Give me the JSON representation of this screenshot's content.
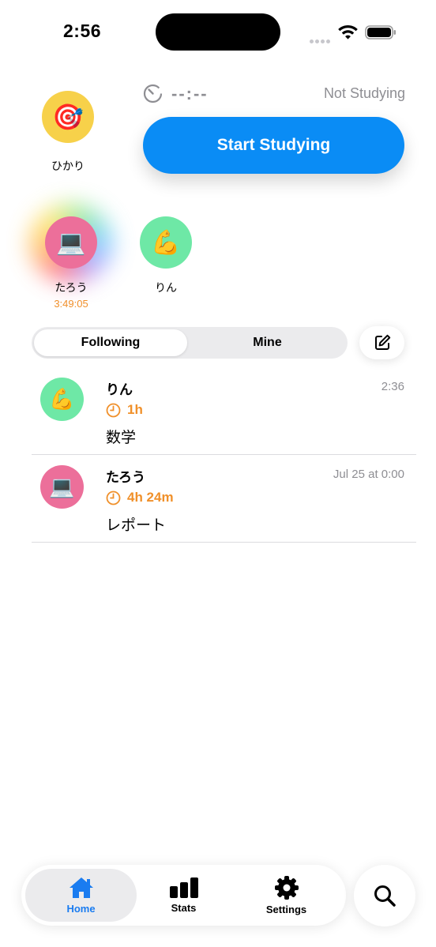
{
  "status_bar": {
    "time": "2:56"
  },
  "profile": {
    "name": "ひかり",
    "avatar_emoji": "🎯",
    "avatar_color": "#f7d14a"
  },
  "timer": {
    "display": "--:--",
    "status": "Not Studying"
  },
  "start_button": {
    "label": "Start Studying",
    "color": "#0a8cf5"
  },
  "friends": [
    {
      "name": "たろう",
      "avatar_emoji": "💻",
      "avatar_color": "#ec6f9a",
      "elapsed": "3:49:05",
      "studying": true
    },
    {
      "name": "りん",
      "avatar_emoji": "💪",
      "avatar_color": "#6ee8a6",
      "elapsed": "",
      "studying": false
    }
  ],
  "segment": {
    "options": [
      "Following",
      "Mine"
    ],
    "selected": "Following"
  },
  "feed": [
    {
      "name": "りん",
      "avatar_emoji": "💪",
      "avatar_color": "#6ee8a6",
      "time": "2:36",
      "duration": "1h",
      "subject": "数学"
    },
    {
      "name": "たろう",
      "avatar_emoji": "💻",
      "avatar_color": "#ec6f9a",
      "time": "Jul 25 at 0:00",
      "duration": "4h 24m",
      "subject": "レポート"
    }
  ],
  "tabs": [
    {
      "label": "Home",
      "icon": "house-icon",
      "active": true
    },
    {
      "label": "Stats",
      "icon": "chart-bars-icon",
      "active": false
    },
    {
      "label": "Settings",
      "icon": "gear-icon",
      "active": false
    }
  ],
  "colors": {
    "accent": "#0a8cf5",
    "tab_active": "#1a7cf0",
    "duration": "#f0902a",
    "muted": "#8e8e93"
  }
}
